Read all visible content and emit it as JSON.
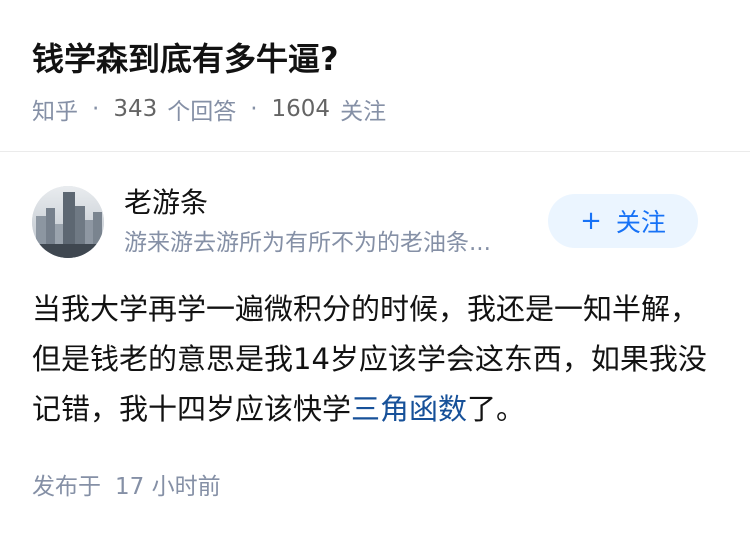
{
  "question": {
    "title": "钱学森到底有多牛逼?",
    "source": "知乎",
    "separator": "·",
    "answer_count": "343",
    "answer_label": "个回答",
    "follower_count": "1604",
    "follower_label": "关注"
  },
  "author": {
    "name": "老游条",
    "bio": "游来游去游所为有所不为的老油条..."
  },
  "follow_button": {
    "icon": "plus-icon",
    "label": "关注"
  },
  "answer": {
    "text_before": "当我大学再学一遍微积分的时候，我还是一知半解，但是钱老的意思是我14岁应该学会这东西，如果我没记错，我十四岁应该快学",
    "link_text": "三角函数",
    "text_after": "了。"
  },
  "publish": {
    "label": "发布于",
    "time": "17 小时前"
  },
  "colors": {
    "title": "#121212",
    "meta": "#8590a6",
    "link": "#175199",
    "follow_button_bg": "#ebf5ff",
    "follow_button_text": "#1772f6"
  }
}
